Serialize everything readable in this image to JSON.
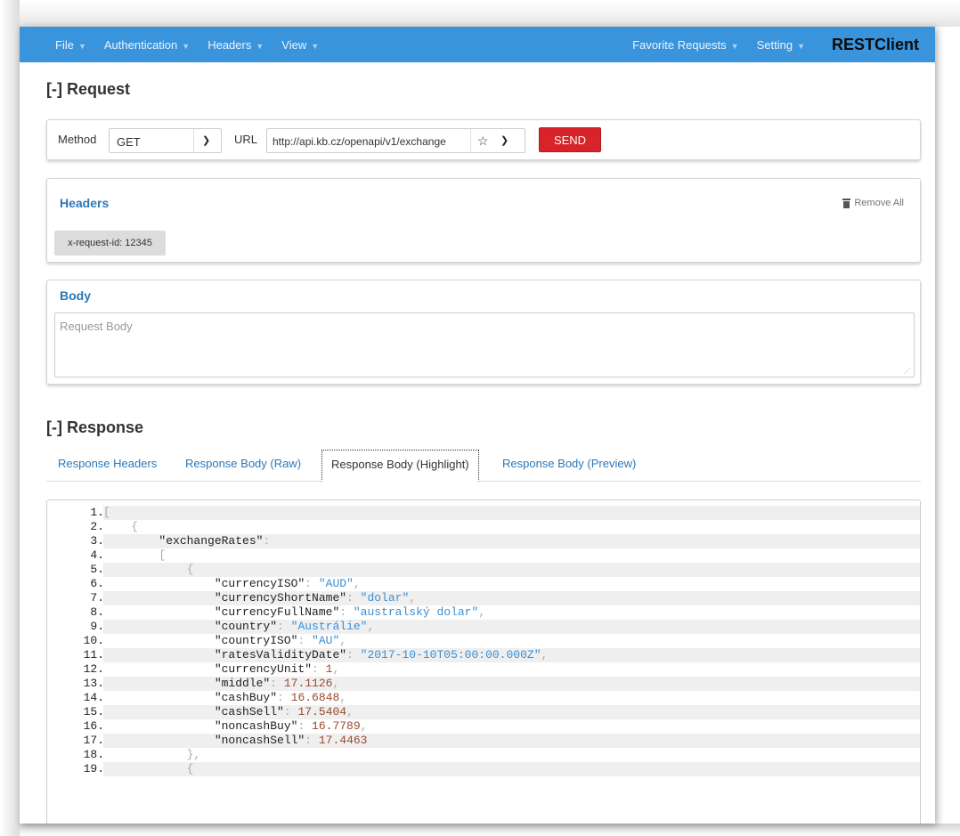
{
  "navbar": {
    "left_items": [
      {
        "label": "File"
      },
      {
        "label": "Authentication"
      },
      {
        "label": "Headers"
      },
      {
        "label": "View"
      }
    ],
    "right_items": [
      {
        "label": "Favorite Requests"
      },
      {
        "label": "Setting"
      }
    ],
    "brand": "RESTClient"
  },
  "request": {
    "title": "[-] Request",
    "method_label": "Method",
    "method_value": "GET",
    "url_label": "URL",
    "url_value": "http://api.kb.cz/openapi/v1/exchange",
    "send_label": "SEND"
  },
  "headers": {
    "title": "Headers",
    "remove_all": "Remove All",
    "items": [
      {
        "label": "x-request-id: 12345"
      }
    ]
  },
  "body": {
    "title": "Body",
    "placeholder": "Request Body"
  },
  "response": {
    "title": "[-] Response",
    "tabs": [
      {
        "label": "Response Headers"
      },
      {
        "label": "Response Body (Raw)"
      },
      {
        "label": "Response Body (Highlight)",
        "active": true
      },
      {
        "label": "Response Body (Preview)"
      }
    ],
    "lines": [
      {
        "num": "1.",
        "tokens": [
          {
            "t": "p",
            "v": "["
          }
        ]
      },
      {
        "num": "2.",
        "tokens": [
          {
            "t": "p",
            "v": "    {"
          }
        ]
      },
      {
        "num": "3.",
        "tokens": [
          {
            "t": "k",
            "v": "        \"exchangeRates\""
          },
          {
            "t": "p",
            "v": ":"
          }
        ]
      },
      {
        "num": "4.",
        "tokens": [
          {
            "t": "p",
            "v": "        ["
          }
        ]
      },
      {
        "num": "5.",
        "tokens": [
          {
            "t": "p",
            "v": "            {"
          }
        ]
      },
      {
        "num": "6.",
        "tokens": [
          {
            "t": "k",
            "v": "                \"currencyISO\""
          },
          {
            "t": "p",
            "v": ": "
          },
          {
            "t": "s",
            "v": "\"AUD\""
          },
          {
            "t": "p",
            "v": ","
          }
        ]
      },
      {
        "num": "7.",
        "tokens": [
          {
            "t": "k",
            "v": "                \"currencyShortName\""
          },
          {
            "t": "p",
            "v": ": "
          },
          {
            "t": "s",
            "v": "\"dolar\""
          },
          {
            "t": "p",
            "v": ","
          }
        ]
      },
      {
        "num": "8.",
        "tokens": [
          {
            "t": "k",
            "v": "                \"currencyFullName\""
          },
          {
            "t": "p",
            "v": ": "
          },
          {
            "t": "s",
            "v": "\"australský dolar\""
          },
          {
            "t": "p",
            "v": ","
          }
        ]
      },
      {
        "num": "9.",
        "tokens": [
          {
            "t": "k",
            "v": "                \"country\""
          },
          {
            "t": "p",
            "v": ": "
          },
          {
            "t": "s",
            "v": "\"Austrálie\""
          },
          {
            "t": "p",
            "v": ","
          }
        ]
      },
      {
        "num": "10.",
        "tokens": [
          {
            "t": "k",
            "v": "                \"countryISO\""
          },
          {
            "t": "p",
            "v": ": "
          },
          {
            "t": "s",
            "v": "\"AU\""
          },
          {
            "t": "p",
            "v": ","
          }
        ]
      },
      {
        "num": "11.",
        "tokens": [
          {
            "t": "k",
            "v": "                \"ratesValidityDate\""
          },
          {
            "t": "p",
            "v": ": "
          },
          {
            "t": "s",
            "v": "\"2017-10-10T05:00:00.000Z\""
          },
          {
            "t": "p",
            "v": ","
          }
        ]
      },
      {
        "num": "12.",
        "tokens": [
          {
            "t": "k",
            "v": "                \"currencyUnit\""
          },
          {
            "t": "p",
            "v": ": "
          },
          {
            "t": "n",
            "v": "1"
          },
          {
            "t": "p",
            "v": ","
          }
        ]
      },
      {
        "num": "13.",
        "tokens": [
          {
            "t": "k",
            "v": "                \"middle\""
          },
          {
            "t": "p",
            "v": ": "
          },
          {
            "t": "n",
            "v": "17.1126"
          },
          {
            "t": "p",
            "v": ","
          }
        ]
      },
      {
        "num": "14.",
        "tokens": [
          {
            "t": "k",
            "v": "                \"cashBuy\""
          },
          {
            "t": "p",
            "v": ": "
          },
          {
            "t": "n",
            "v": "16.6848"
          },
          {
            "t": "p",
            "v": ","
          }
        ]
      },
      {
        "num": "15.",
        "tokens": [
          {
            "t": "k",
            "v": "                \"cashSell\""
          },
          {
            "t": "p",
            "v": ": "
          },
          {
            "t": "n",
            "v": "17.5404"
          },
          {
            "t": "p",
            "v": ","
          }
        ]
      },
      {
        "num": "16.",
        "tokens": [
          {
            "t": "k",
            "v": "                \"noncashBuy\""
          },
          {
            "t": "p",
            "v": ": "
          },
          {
            "t": "n",
            "v": "16.7789"
          },
          {
            "t": "p",
            "v": ","
          }
        ]
      },
      {
        "num": "17.",
        "tokens": [
          {
            "t": "k",
            "v": "                \"noncashSell\""
          },
          {
            "t": "p",
            "v": ": "
          },
          {
            "t": "n",
            "v": "17.4463"
          }
        ]
      },
      {
        "num": "18.",
        "tokens": [
          {
            "t": "p",
            "v": "            },"
          }
        ]
      },
      {
        "num": "19.",
        "tokens": [
          {
            "t": "p",
            "v": "            {"
          }
        ]
      }
    ]
  },
  "colors": {
    "navbar": "#3a94dc",
    "send_button": "#d9232a",
    "link": "#2a78b9",
    "string": "#3a8fd4",
    "number": "#9a4a2f"
  },
  "icons": [
    "chevron-down-icon",
    "star-icon",
    "trash-icon",
    "resize-grip-icon"
  ]
}
